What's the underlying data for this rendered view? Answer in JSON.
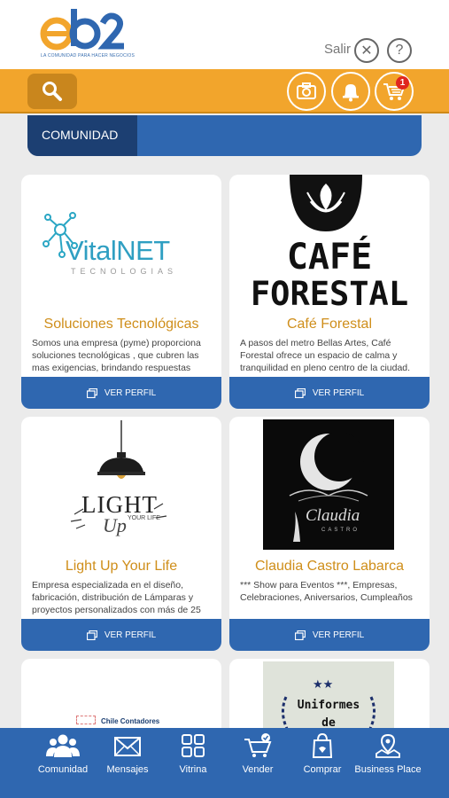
{
  "header": {
    "logo_text": "eb2",
    "logo_tagline": "LA COMUNIDAD PARA HACER NEGOCIOS",
    "logout_label": "Salir",
    "cart_badge": "1",
    "colors": {
      "orange": "#f2a52c",
      "blue": "#2f67b0",
      "dark_blue": "#1c3f72"
    }
  },
  "section": {
    "tab_label": "COMUNIDAD"
  },
  "cards": [
    {
      "logo_text": "VitalNET",
      "logo_subtext": "TECNOLOGIAS",
      "title": "Soluciones Tecnológicas",
      "description": "Somos una empresa (pyme) proporciona soluciones tecnológicas , que cubren las mas exigencias, brindando respuestas",
      "button": "VER PERFIL"
    },
    {
      "logo_text": "CAFÉ",
      "logo_subtext": "FORESTAL",
      "title": "Café Forestal",
      "description": "A pasos del metro Bellas Artes, Café Forestal ofrece un espacio de calma y tranquilidad en pleno centro de la ciudad.",
      "button": "VER PERFIL"
    },
    {
      "logo_text": "LIGHT",
      "logo_subtext": "YOUR LIFE",
      "logo_script": "Up",
      "title": "Light Up Your Life",
      "description": "Empresa especializada en el diseño, fabricación, distribución de Lámparas y proyectos personalizados con más de 25",
      "button": "VER PERFIL"
    },
    {
      "logo_text": "Claudia",
      "logo_subtext": "CASTRO",
      "title": "Claudia Castro Labarca",
      "description": "*** Show para Eventos ***, Empresas, Celebraciones, Aniversarios, Cumpleaños",
      "button": "VER PERFIL"
    },
    {
      "logo_text": "Chile Contadores"
    },
    {
      "logo_text": "Uniformes",
      "logo_subtext": "de"
    }
  ],
  "nav": [
    {
      "label": "Comunidad",
      "icon": "people-icon"
    },
    {
      "label": "Mensajes",
      "icon": "envelope-icon"
    },
    {
      "label": "Vitrina",
      "icon": "grid-icon"
    },
    {
      "label": "Vender",
      "icon": "cart-check-icon"
    },
    {
      "label": "Comprar",
      "icon": "shopping-bag-icon"
    },
    {
      "label": "Business Place",
      "icon": "map-pin-icon"
    }
  ]
}
